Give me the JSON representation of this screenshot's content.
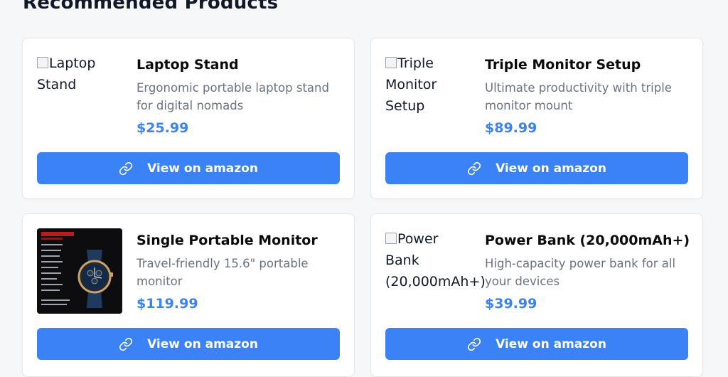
{
  "section": {
    "title": "Recommended Products"
  },
  "products": [
    {
      "alt": "Laptop Stand",
      "name": "Laptop Stand",
      "description": "Ergonomic portable laptop stand for digital nomads",
      "price": "$25.99",
      "button": "View on amazon"
    },
    {
      "alt": "Triple Monitor Setup",
      "name": "Triple Monitor Setup",
      "description": "Ultimate productivity with triple monitor mount",
      "price": "$89.99",
      "button": "View on amazon"
    },
    {
      "alt": "Single Portable Monitor",
      "name": "Single Portable Monitor",
      "description": "Travel-friendly 15.6\" portable monitor",
      "price": "$119.99",
      "button": "View on amazon"
    },
    {
      "alt": "Power Bank (20,000mAh+)",
      "name": "Power Bank (20,000mAh+)",
      "description": "High-capacity power bank for all your devices",
      "price": "$39.99",
      "button": "View on amazon"
    }
  ],
  "colors": {
    "accent": "#3b82f6",
    "muted": "#6b7280",
    "background": "#f6f7f9"
  }
}
